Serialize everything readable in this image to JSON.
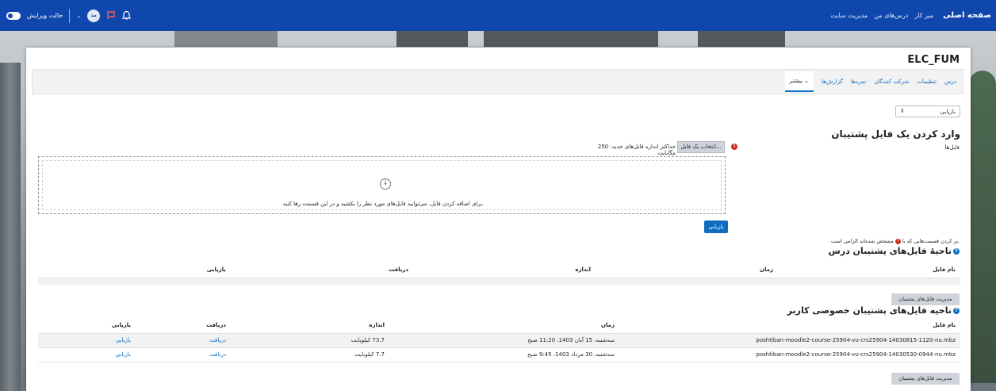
{
  "navbar": {
    "brand": "صفحه اصلی",
    "links": [
      "میز کار",
      "درس‌های من",
      "مدیریت سایت"
    ],
    "edit_mode_label": "حالت ویرایش",
    "avatar_initials": "مد"
  },
  "course": {
    "title": "ELC_FUM"
  },
  "secondary_nav": {
    "tabs": [
      "درس",
      "تنظیمات",
      "شرکت کنندگان",
      "نمره‌ها",
      "گزارش‌ها",
      "بیشتر ⌄"
    ],
    "active_index": 5
  },
  "action_select": {
    "value": "بازیابی"
  },
  "import_section": {
    "heading": "وارد کردن یک فایل پشتیبان",
    "files_label": "فایل‌ها",
    "required_mark": "!",
    "choose_button": "انتخاب یک فایل...",
    "max_size": "حداکثر اندازه فایل‌های جدید: 250 مگابایت",
    "dropzone_text": "برای اضافه کردن فایل، می‌توانید فایل‌های مورد نظر را بکشید و در این قسمت رها کنید.",
    "restore_button": "بازیابی",
    "required_note_before": "پر کردن قسمت‌هایی که با",
    "required_note_after": "مشخص شده‌اند الزامی است."
  },
  "course_backup": {
    "heading": "ناحیهٔ فایل‌های پشتیبان درس",
    "columns": [
      "نام فایل",
      "زمان",
      "اندازه",
      "دریافت",
      "بازیابی"
    ],
    "manage_button": "مدیریت فایل‌های پشتیبان"
  },
  "user_backup": {
    "heading": "ناحیه فایل‌های پشتیبان خصوصی کاربر",
    "columns": [
      "نام فایل",
      "زمان",
      "اندازه",
      "دریافت",
      "بازیابی"
    ],
    "rows": [
      {
        "filename": "poshtiban-moodle2-course-25904-vu-crs25904-14030815-1120-nu.mbz",
        "time": "سه‌شنبه، 15 آبان 1403، 11:20 صبح",
        "size": "73.7 کیلوبایت",
        "download": "دریافت",
        "restore": "بازیابی"
      },
      {
        "filename": "poshtiban-moodle2-course-25904-vu-crs25904-14030530-0944-nu.mbz",
        "time": "سه‌شنبه، 30 مرداد 1403، 9:45 صبح",
        "size": "7.7 کیلوبایت",
        "download": "دریافت",
        "restore": "بازیابی"
      }
    ],
    "manage_button": "مدیریت فایل‌های پشتیبان"
  },
  "colors": {
    "navbar": "#0f47ad",
    "link": "#0f6cbf",
    "required": "#ca3120"
  }
}
